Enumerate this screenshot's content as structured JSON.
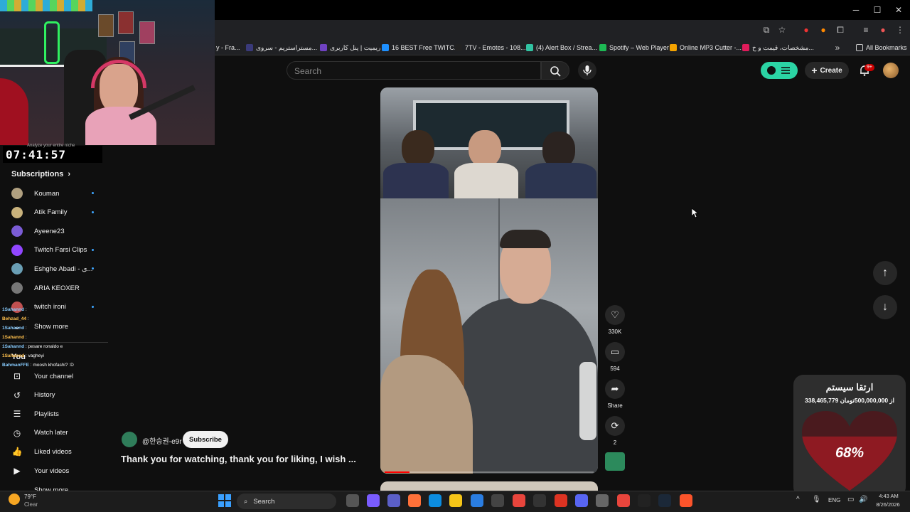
{
  "browser": {
    "bookmarks": [
      {
        "label": "y - Fra...",
        "color": "#444"
      },
      {
        "label": "مستراستریم - سروی...",
        "color": "#3a3a7a"
      },
      {
        "label": "ریمیت | پنل کاربری",
        "color": "#6f42c1"
      },
      {
        "label": "16 BEST Free TWITC...",
        "color": "#1e90ff"
      },
      {
        "label": "7TV - Emotes - 108...",
        "color": "#222"
      },
      {
        "label": "(4) Alert Box / Strea...",
        "color": "#31c3a2"
      },
      {
        "label": "Spotify – Web Player",
        "color": "#1db954"
      },
      {
        "label": "Online MP3 Cutter -...",
        "color": "#f4a300"
      },
      {
        "label": "مشخصات، قیمت و خ...",
        "color": "#e01b5a"
      }
    ],
    "all_bookmarks": "All Bookmarks"
  },
  "header": {
    "search_placeholder": "Search",
    "create_label": "Create",
    "notification_count": "9+"
  },
  "overlay": {
    "timer": "07:41:57",
    "timer_note": "Analyze your entire niche"
  },
  "sidebar": {
    "subscriptions_heading": "Subscriptions",
    "subscriptions": [
      {
        "label": "Kouman",
        "color": "#b0a080",
        "new": true
      },
      {
        "label": "Atik Family",
        "color": "#c9b27c",
        "new": true
      },
      {
        "label": "Ayeene23",
        "color": "#7b5cd6",
        "new": false
      },
      {
        "label": "Twitch Farsi Clips",
        "color": "#9146ff",
        "new": true
      },
      {
        "label": "Eshghe Abadi - ی...",
        "color": "#6a9fb5",
        "new": true
      },
      {
        "label": "ARIA KEOXER",
        "color": "#777",
        "new": false
      },
      {
        "label": "twitch ironi",
        "color": "#c05050",
        "new": true
      }
    ],
    "show_more": "Show more",
    "you_heading": "You",
    "you_items": [
      {
        "label": "Your channel",
        "icon": "user-box-icon"
      },
      {
        "label": "History",
        "icon": "history-icon"
      },
      {
        "label": "Playlists",
        "icon": "playlist-icon"
      },
      {
        "label": "Watch later",
        "icon": "clock-icon"
      },
      {
        "label": "Liked videos",
        "icon": "thumbs-up-icon"
      },
      {
        "label": "Your videos",
        "icon": "video-icon"
      }
    ],
    "show_more_2": "Show more"
  },
  "chat": [
    {
      "user": "1Sahannd",
      "text": ":",
      "top": 0
    },
    {
      "user": "Behzad_44",
      "text": ":",
      "top": 0
    },
    {
      "user": "1Sahannd",
      "text": ":",
      "top": 0
    },
    {
      "user": "1Sahannd",
      "text": ":",
      "top": 0
    },
    {
      "user": "1Sahannd",
      "text": ": pesare ronaldo e",
      "top": 0
    },
    {
      "user": "1Sahannd",
      "text": ": vagheyi",
      "top": 0
    },
    {
      "user": "BahmanFFE",
      "text": ": moosh khofashi? :D",
      "top": 0
    }
  ],
  "short": {
    "channel_name": "@한승권-e9r",
    "subscribe_label": "Subscribe",
    "title": "Thank you for watching, thank you for liking, I wish ...",
    "progress": 0.12,
    "actions": {
      "likes": "330K",
      "comments": "594",
      "share": "Share",
      "remix": "2"
    }
  },
  "donation": {
    "title": "ارتقا سیستم",
    "amount_text": "338,465,779 از 500,000,000تومان",
    "percent": "68%",
    "fraction": 0.68
  },
  "taskbar": {
    "weather_temp": "79°F",
    "weather_cond": "Clear",
    "search_label": "Search",
    "language": "ENG",
    "time": "4:43 AM",
    "date": "8/26/2026"
  }
}
